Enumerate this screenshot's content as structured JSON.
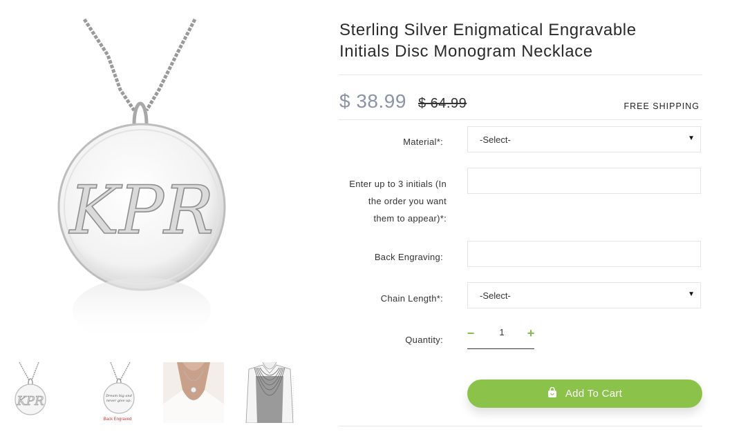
{
  "product": {
    "title_line1": "Sterling Silver Enigmatical Engravable",
    "title_line2": "Initials Disc Monogram Necklace",
    "price": "$ 38.99",
    "old_price": "$ 64.99",
    "shipping": "FREE SHIPPING"
  },
  "gallery": {
    "main_image_text": "KPR",
    "thumbnails": [
      {
        "name": "front-disc",
        "text": "KPR"
      },
      {
        "name": "back-disc",
        "text": "Dream big and never give up.",
        "caption": "Back Engraved"
      },
      {
        "name": "model-photo"
      },
      {
        "name": "chain-length-chart"
      }
    ]
  },
  "form": {
    "material": {
      "label": "Material*:",
      "value": "-Select-"
    },
    "initials": {
      "label_line1": "Enter up to 3 initials (In",
      "label_line2": "the order you want",
      "label_line3": "them to appear)*:",
      "value": ""
    },
    "back_engraving": {
      "label": "Back Engraving:",
      "value": ""
    },
    "chain_length": {
      "label": "Chain Length*:",
      "value": "-Select-"
    },
    "quantity": {
      "label": "Quantity:",
      "value": "1",
      "minus": "−",
      "plus": "+"
    }
  },
  "cart": {
    "label": "Add To Cart",
    "icon": "shopping-bag-icon"
  },
  "colors": {
    "accent": "#8bc34a",
    "price": "#8a93a6"
  }
}
